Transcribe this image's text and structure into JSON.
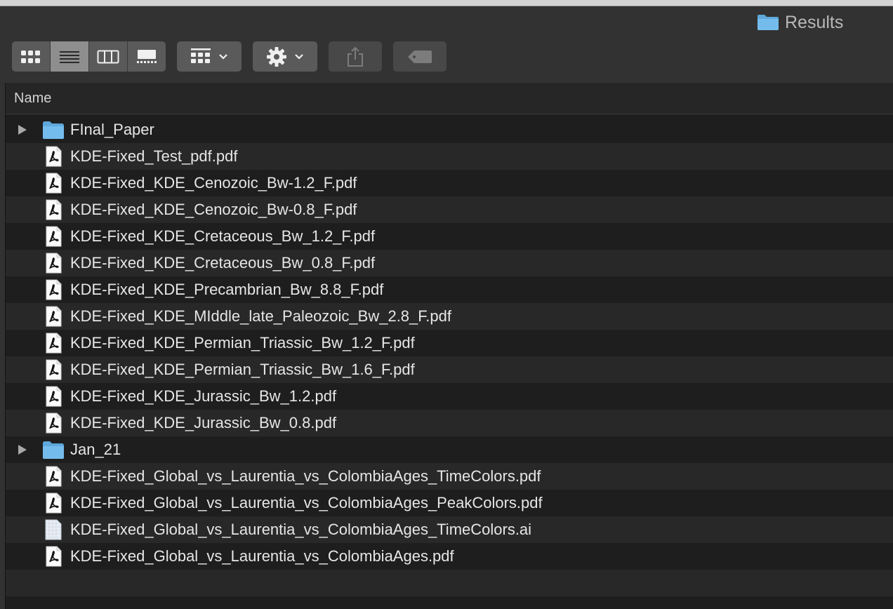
{
  "window": {
    "title": "Results",
    "title_icon": "folder-icon"
  },
  "toolbar": {
    "view_modes": [
      "icon-view-icon",
      "list-view-icon",
      "column-view-icon",
      "gallery-view-icon"
    ],
    "active_view": "list-view-icon",
    "group_button_icon": "group-grid-icon",
    "action_button_icon": "gear-icon",
    "share_button_icon": "share-icon",
    "tag_button_icon": "tag-icon"
  },
  "header": {
    "name_column": "Name"
  },
  "files": [
    {
      "name": "FInal_Paper",
      "type": "folder"
    },
    {
      "name": "KDE-Fixed_Test_pdf.pdf",
      "type": "pdf"
    },
    {
      "name": "KDE-Fixed_KDE_Cenozoic_Bw-1.2_F.pdf",
      "type": "pdf"
    },
    {
      "name": "KDE-Fixed_KDE_Cenozoic_Bw-0.8_F.pdf",
      "type": "pdf"
    },
    {
      "name": "KDE-Fixed_KDE_Cretaceous_Bw_1.2_F.pdf",
      "type": "pdf"
    },
    {
      "name": "KDE-Fixed_KDE_Cretaceous_Bw_0.8_F.pdf",
      "type": "pdf"
    },
    {
      "name": "KDE-Fixed_KDE_Precambrian_Bw_8.8_F.pdf",
      "type": "pdf"
    },
    {
      "name": "KDE-Fixed_KDE_MIddle_late_Paleozoic_Bw_2.8_F.pdf",
      "type": "pdf"
    },
    {
      "name": "KDE-Fixed_KDE_Permian_Triassic_Bw_1.2_F.pdf",
      "type": "pdf"
    },
    {
      "name": "KDE-Fixed_KDE_Permian_Triassic_Bw_1.6_F.pdf",
      "type": "pdf"
    },
    {
      "name": "KDE-Fixed_KDE_Jurassic_Bw_1.2.pdf",
      "type": "pdf"
    },
    {
      "name": "KDE-Fixed_KDE_Jurassic_Bw_0.8.pdf",
      "type": "pdf"
    },
    {
      "name": "Jan_21",
      "type": "folder"
    },
    {
      "name": "KDE-Fixed_Global_vs_Laurentia_vs_ColombiaAges_TimeColors.pdf",
      "type": "pdf"
    },
    {
      "name": "KDE-Fixed_Global_vs_Laurentia_vs_ColombiaAges_PeakColors.pdf",
      "type": "pdf"
    },
    {
      "name": "KDE-Fixed_Global_vs_Laurentia_vs_ColombiaAges_TimeColors.ai",
      "type": "ai"
    },
    {
      "name": "KDE-Fixed_Global_vs_Laurentia_vs_ColombiaAges.pdf",
      "type": "pdf"
    }
  ],
  "colors": {
    "folder_blue": "#6bb4e6",
    "row_odd": "#1e1e1e",
    "row_even": "#282828",
    "toolbar_bg": "#323232",
    "button_bg": "#5a5a5a",
    "active_segment": "#8e8e8e"
  }
}
